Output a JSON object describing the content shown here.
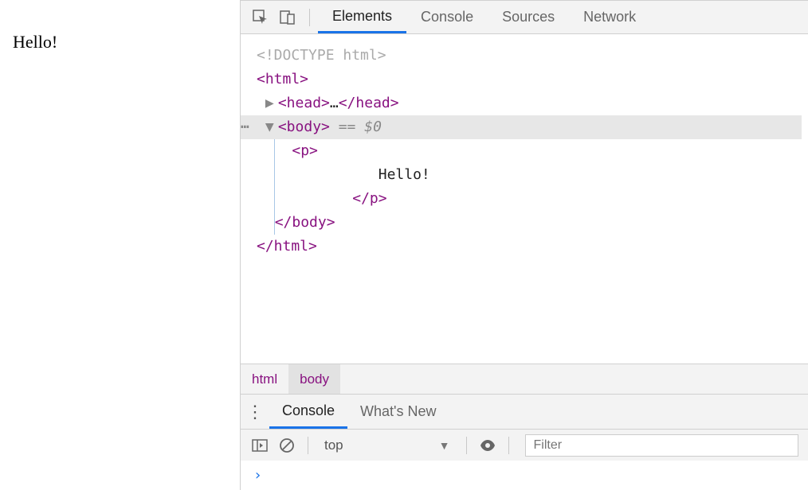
{
  "page": {
    "content": "Hello!"
  },
  "toolbar": {
    "tabs": [
      {
        "label": "Elements",
        "active": true
      },
      {
        "label": "Console",
        "active": false
      },
      {
        "label": "Sources",
        "active": false
      },
      {
        "label": "Network",
        "active": false
      }
    ]
  },
  "dom": {
    "doctype": "<!DOCTYPE html>",
    "html_open": "<html>",
    "head_open": "<head>",
    "head_ellipsis": "…",
    "head_close": "</head>",
    "body_open": "<body>",
    "body_eq": " == ",
    "body_ref": "$0",
    "p_open": "<p>",
    "p_text": "Hello!",
    "p_close": "</p>",
    "body_close": "</body>",
    "html_close": "</html>"
  },
  "breadcrumb": {
    "items": [
      {
        "label": "html",
        "selected": false
      },
      {
        "label": "body",
        "selected": true
      }
    ]
  },
  "drawer": {
    "tabs": [
      {
        "label": "Console",
        "active": true
      },
      {
        "label": "What's New",
        "active": false
      }
    ]
  },
  "console": {
    "context": "top",
    "filter_placeholder": "Filter",
    "prompt": "›"
  }
}
